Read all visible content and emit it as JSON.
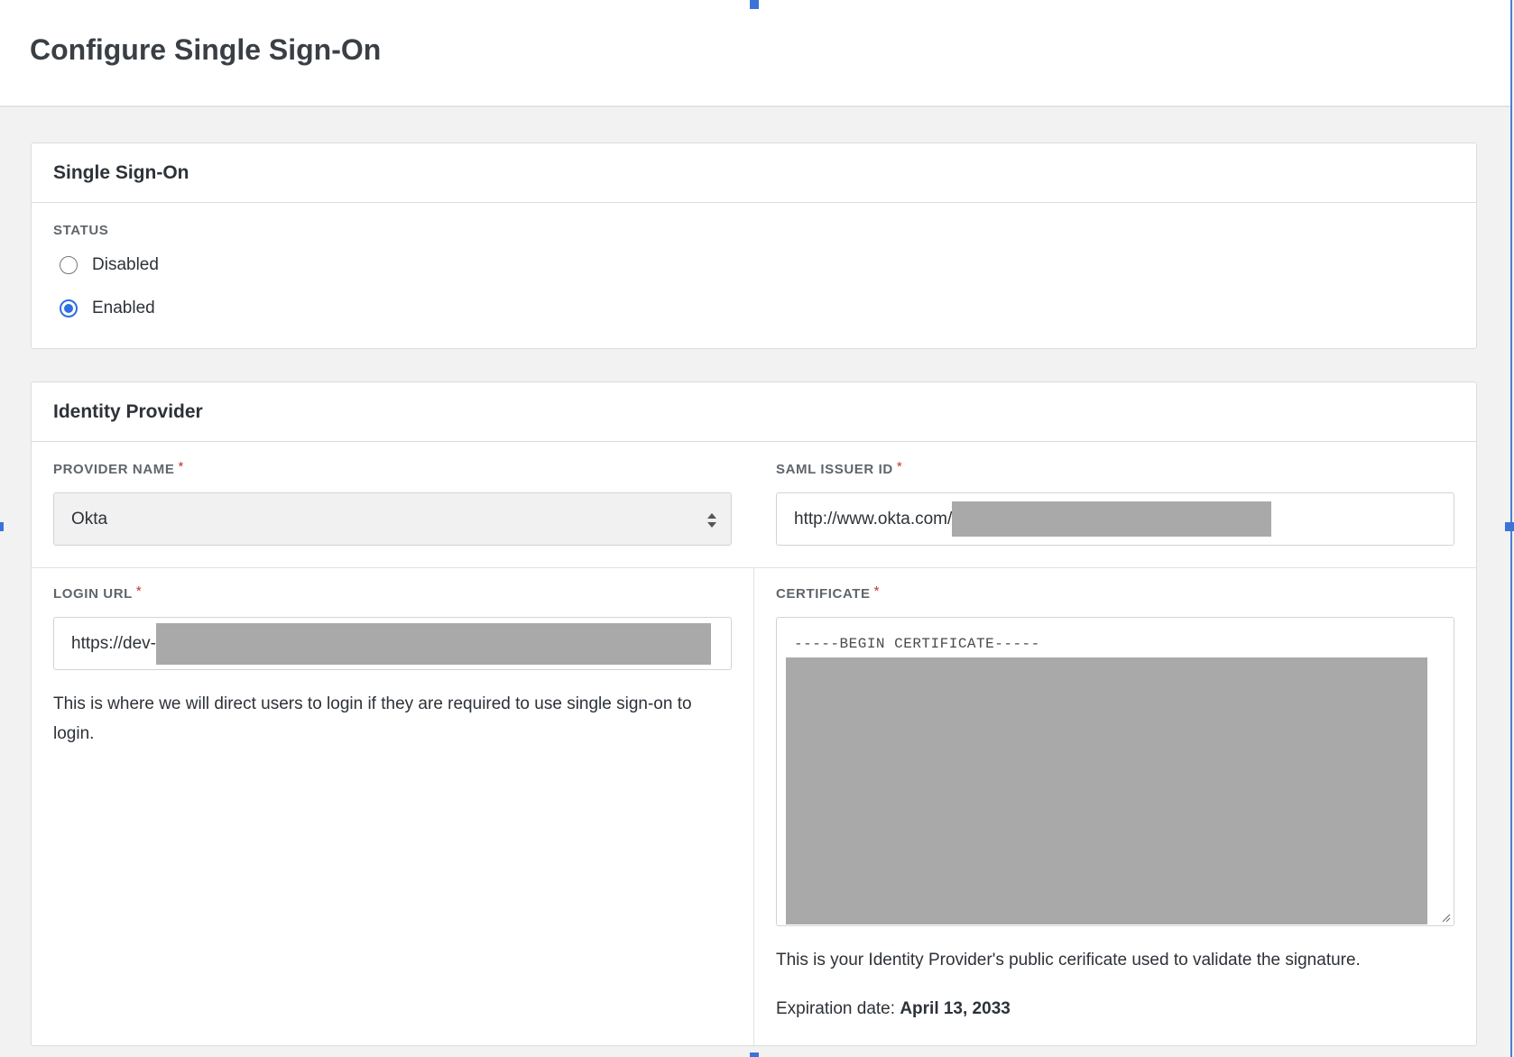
{
  "page": {
    "title": "Configure Single Sign-On"
  },
  "sso_card": {
    "title": "Single Sign-On",
    "status_label": "STATUS",
    "options": [
      {
        "label": "Disabled",
        "checked": false
      },
      {
        "label": "Enabled",
        "checked": true
      }
    ]
  },
  "idp_card": {
    "title": "Identity Provider",
    "provider_name": {
      "label": "PROVIDER NAME",
      "required_mark": "*",
      "value": "Okta"
    },
    "saml_issuer_id": {
      "label": "SAML ISSUER ID",
      "required_mark": "*",
      "value": "http://www.okta.com/"
    },
    "login_url": {
      "label": "LOGIN URL",
      "required_mark": "*",
      "value": "https://dev-",
      "help": "This is where we will direct users to login if they are required to use single sign-on to login."
    },
    "certificate": {
      "label": "CERTIFICATE",
      "required_mark": "*",
      "first_line": "-----BEGIN CERTIFICATE-----",
      "help": "This is your Identity Provider's public cerificate used to validate the signature.",
      "expiration_label": "Expiration date:",
      "expiration_value": "April 13, 2033"
    }
  },
  "colors": {
    "accent": "#2f6fe0",
    "required": "#c9302c",
    "redaction": "#a9a9a9"
  }
}
